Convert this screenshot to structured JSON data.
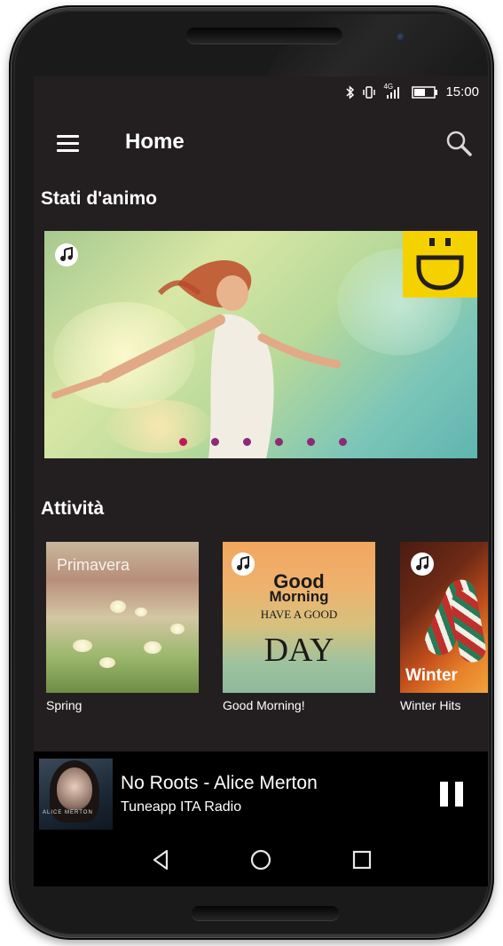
{
  "status_bar": {
    "time": "15:00",
    "network_label": "4G",
    "icons": [
      "bluetooth-icon",
      "vibrate-icon",
      "signal-icon",
      "battery-icon"
    ]
  },
  "app_bar": {
    "title": "Home",
    "menu_icon": "hamburger-menu-icon",
    "search_icon": "search-icon"
  },
  "moods": {
    "section_title": "Stati d'animo",
    "banner_icons": [
      "music-note-icon",
      "smiley-face-icon"
    ],
    "slide_count": 6,
    "active_slide": 1
  },
  "activities": {
    "section_title": "Attività",
    "items": [
      {
        "label": "Spring",
        "thumb_text": "Primavera"
      },
      {
        "label": "Good Morning!",
        "thumb_line1": "Good",
        "thumb_line2": "Morning",
        "thumb_line3": "HAVE A GOOD",
        "thumb_line4": "DAY"
      },
      {
        "label": "Winter Hits",
        "thumb_text": "Winter"
      }
    ]
  },
  "player": {
    "title": "No Roots - Alice Merton",
    "station": "Tuneapp ITA Radio",
    "album_text": "ALICE MERTON",
    "state": "playing"
  },
  "nav_bar": {
    "icons": [
      "back-icon",
      "home-icon",
      "recents-icon"
    ]
  },
  "colors": {
    "background": "#231f20",
    "accent_dot_active": "#c2185b",
    "accent_dot": "#8b2b78",
    "smiley_yellow": "#f6d100"
  }
}
